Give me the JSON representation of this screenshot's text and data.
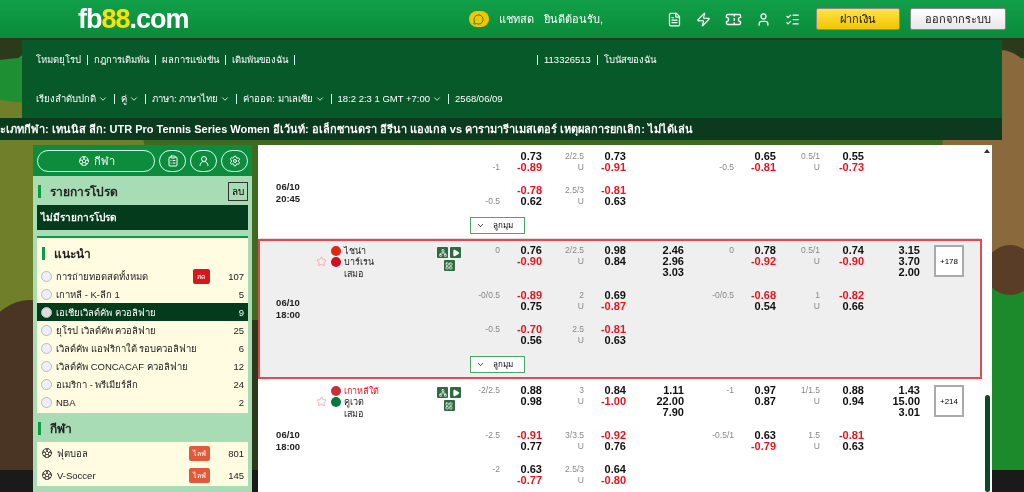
{
  "header": {
    "logo": "fb**88**.com",
    "chat": "แชทสด",
    "welcome": "ยินดีต้อนรับ,",
    "buttons": [
      {
        "kind": "deposit",
        "label": "ฝากเงิน"
      },
      {
        "kind": "logout",
        "label": "ออกจากระบบ"
      }
    ]
  },
  "nav_links": [
    "โหมดยุโรป",
    "กฎการเดิมพัน",
    "ผลการแข่งขัน",
    "เดิมพันของฉัน",
    "113326513",
    "โบนัสของฉัน"
  ],
  "dropdowns": [
    "เรียงลำดับปกติ",
    "คู่",
    "ภาษา: ภาษาไทย",
    "ค่าออด: มาเลเซีย",
    "18:2 2:3 1 GMT +7:00"
  ],
  "date_text": "2568/06/09",
  "banner": "ะเภทกีฬา: เทนนิส ลีก: UTR Pro Tennis Series Women อีเว้นท์: อเล็กซานดรา อีรีนา แองเกล vs คารามารีาเมสเตอร์ เหตุผลการยกเลิก: ไม่ได้เล่น",
  "sidebar": {
    "sport_button": "กีฬา",
    "favorites": {
      "title": "รายการโปรด",
      "clear": "ลบ",
      "empty": "ไม่มีรายการโปรด"
    },
    "recommended": {
      "title": "แนะนำ",
      "items": [
        {
          "name": "การถ่ายทอดสดทั้งหมด",
          "badge": "สด",
          "count": "107",
          "selected": false
        },
        {
          "name": "เกาหลี - K-ลีก 1",
          "count": "5",
          "selected": false
        },
        {
          "name": "เอเชียเวิลด์คัพ ควอลิฟาย",
          "count": "9",
          "selected": true
        },
        {
          "name": "ยุโรป เวิลด์คัพ ควอลิฟาย",
          "count": "25",
          "selected": false
        },
        {
          "name": "เวิลด์คัพ แอฟริกาใต้ รอบควอลิฟาย",
          "count": "6",
          "selected": false
        },
        {
          "name": "เวิลด์คัพ CONCACAF ควอลิฟาย",
          "count": "12",
          "selected": false
        },
        {
          "name": "อเมริกา - พรีเมียร์ลีก",
          "count": "24",
          "selected": false
        },
        {
          "name": "NBA",
          "count": "2",
          "selected": false
        }
      ]
    },
    "sports": {
      "title": "กีฬา",
      "items": [
        {
          "name": "ฟุตบอล",
          "badge": "ไลฟ์",
          "count": "801",
          "selected": false
        },
        {
          "name": "V-Soccer",
          "badge": "ไลฟ์",
          "count": "145",
          "selected": false
        }
      ]
    }
  },
  "matches": [
    {
      "date": "06/10",
      "time": "20:45",
      "selected": false,
      "rows": [
        {
          "ft_hdp": {
            "bottom_line": "-1",
            "odds": [
              "0.73",
              "-0.89"
            ]
          },
          "ft_ou": {
            "line": "2/2.5",
            "under": "U",
            "odds": [
              "0.73",
              "-0.91"
            ]
          },
          "h1_hdp": {
            "bottom_line": "-0.5",
            "odds": [
              "0.65",
              "-0.81"
            ]
          },
          "h1_ou": {
            "line": "0.5/1",
            "under": "U",
            "odds": [
              "0.55",
              "-0.73"
            ]
          }
        },
        {
          "ft_hdp": {
            "bottom_line": "-0.5",
            "odds": [
              "-0.78",
              "0.62"
            ]
          },
          "ft_ou": {
            "line": "2.5/3",
            "under": "U",
            "odds": [
              "-0.81",
              "0.63"
            ]
          }
        }
      ],
      "corner": "ลูกมุม"
    },
    {
      "date": "06/10",
      "time": "18:00",
      "selected": true,
      "starred": false,
      "teams": [
        {
          "name": "ไชน่า",
          "favorite": false,
          "color": "#de2910"
        },
        {
          "name": "บาร์เรน",
          "favorite": false,
          "color": "#ce1126"
        }
      ],
      "draw": "เสมอ",
      "more": "+178",
      "rows": [
        {
          "ft_hdp": {
            "top_line": "0",
            "odds": [
              "0.76",
              "-0.90"
            ]
          },
          "ft_ou": {
            "line": "2/2.5",
            "under": "U",
            "odds": [
              "0.98",
              "0.84"
            ]
          },
          "ft_1x2": [
            "2.46",
            "2.96",
            "3.03"
          ],
          "h1_hdp": {
            "top_line": "0",
            "odds": [
              "0.78",
              "-0.92"
            ]
          },
          "h1_ou": {
            "line": "0.5/1",
            "under": "U",
            "odds": [
              "0.74",
              "-0.90"
            ]
          },
          "h1_1x2": [
            "3.15",
            "3.70",
            "2.00"
          ]
        },
        {
          "ft_hdp": {
            "top_line": "-0/0.5",
            "odds": [
              "-0.89",
              "0.75"
            ]
          },
          "ft_ou": {
            "line": "2",
            "under": "U",
            "odds": [
              "0.69",
              "-0.87"
            ]
          },
          "h1_hdp": {
            "top_line": "-0/0.5",
            "odds": [
              "-0.68",
              "0.54"
            ]
          },
          "h1_ou": {
            "line": "1",
            "under": "U",
            "odds": [
              "-0.82",
              "0.66"
            ]
          }
        },
        {
          "ft_hdp": {
            "top_line": "-0.5",
            "odds": [
              "-0.70",
              "0.56"
            ]
          },
          "ft_ou": {
            "line": "2.5",
            "under": "U",
            "odds": [
              "-0.81",
              "0.63"
            ]
          }
        }
      ],
      "corner": "ลูกมุม"
    },
    {
      "date": "06/10",
      "time": "18:00",
      "selected": false,
      "starred": false,
      "teams": [
        {
          "name": "เกาหลีใต้",
          "favorite": true,
          "color": "#cd2e3a"
        },
        {
          "name": "คูเวต",
          "favorite": false,
          "color": "#007a3d"
        }
      ],
      "draw": "เสมอ",
      "more": "+214",
      "rows": [
        {
          "ft_hdp": {
            "top_line": "-2/2.5",
            "odds": [
              "0.88",
              "0.98"
            ]
          },
          "ft_ou": {
            "line": "3",
            "under": "U",
            "odds": [
              "0.84",
              "-1.00"
            ]
          },
          "ft_1x2": [
            "1.11",
            "22.00",
            "7.90"
          ],
          "h1_hdp": {
            "top_line": "-1",
            "odds": [
              "0.97",
              "0.87"
            ]
          },
          "h1_ou": {
            "line": "1/1.5",
            "under": "U",
            "odds": [
              "0.88",
              "0.94"
            ]
          },
          "h1_1x2": [
            "1.43",
            "15.00",
            "3.01"
          ]
        },
        {
          "ft_hdp": {
            "top_line": "-2.5",
            "odds": [
              "-0.91",
              "0.77"
            ]
          },
          "ft_ou": {
            "line": "3/3.5",
            "under": "U",
            "odds": [
              "-0.92",
              "0.76"
            ]
          },
          "h1_hdp": {
            "top_line": "-0.5/1",
            "odds": [
              "0.63",
              "-0.79"
            ]
          },
          "h1_ou": {
            "line": "1.5",
            "under": "U",
            "odds": [
              "-0.81",
              "0.63"
            ]
          }
        },
        {
          "ft_hdp": {
            "top_line": "-2",
            "odds": [
              "0.63",
              "-0.77"
            ]
          },
          "ft_ou": {
            "line": "2.5/3",
            "under": "U",
            "odds": [
              "0.64",
              "-0.80"
            ]
          }
        }
      ]
    }
  ]
}
